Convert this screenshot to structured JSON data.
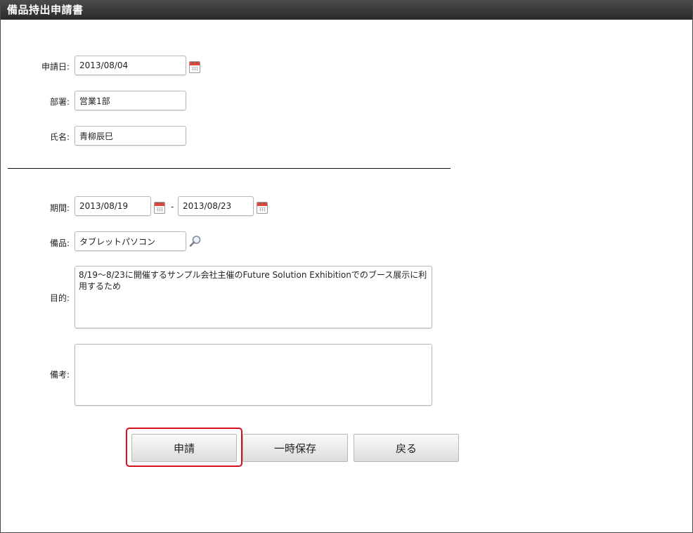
{
  "window": {
    "title": "備品持出申請書"
  },
  "form": {
    "apply_date": {
      "label": "申請日:",
      "value": "2013/08/04"
    },
    "department": {
      "label": "部署:",
      "value": "営業1部"
    },
    "name": {
      "label": "氏名:",
      "value": "青柳辰巳"
    },
    "period": {
      "label": "期間:",
      "start": "2013/08/19",
      "separator": "-",
      "end": "2013/08/23"
    },
    "equipment": {
      "label": "備品:",
      "value": "タブレットパソコン"
    },
    "purpose": {
      "label": "目的:",
      "value": "8/19〜8/23に開催するサンプル会社主催のFuture Solution Exhibitionでのブース展示に利用するため"
    },
    "remarks": {
      "label": "備考:",
      "value": ""
    }
  },
  "buttons": {
    "apply": "申請",
    "save_draft": "一時保存",
    "back": "戻る"
  },
  "colors": {
    "titlebar": "#2f2f2f",
    "highlight": "#d3101c",
    "calendar_header": "#e2463b"
  }
}
